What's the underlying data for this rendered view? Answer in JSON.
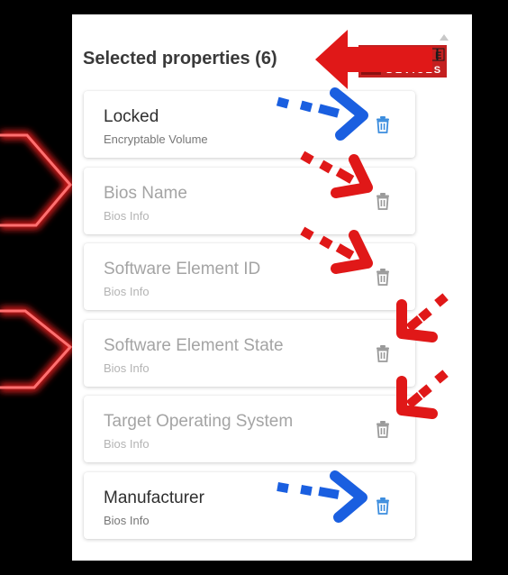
{
  "panel": {
    "title": "Selected properties (6)",
    "items": [
      {
        "name": "Locked",
        "category": "Encryptable Volume",
        "enabled": true
      },
      {
        "name": "Bios Name",
        "category": "Bios Info",
        "enabled": false
      },
      {
        "name": "Software Element ID",
        "category": "Bios Info",
        "enabled": false
      },
      {
        "name": "Software Element State",
        "category": "Bios Info",
        "enabled": false
      },
      {
        "name": "Target Operating System",
        "category": "Bios Info",
        "enabled": false
      },
      {
        "name": "Manufacturer",
        "category": "Bios Info",
        "enabled": true
      }
    ]
  },
  "logo": {
    "how": "HOW",
    "to": "TO",
    "manage": "MANAGE",
    "devices": "DEVICES"
  },
  "icons": {
    "delete": "trash-icon",
    "scroll": "scroll-up-icon"
  },
  "colors": {
    "enabled_trash": "#3c8dde",
    "disabled_trash": "#9a9a9a",
    "annotation_red": "#e01818",
    "annotation_blue": "#1a5fe0",
    "neon_glow": "#ff2020"
  }
}
